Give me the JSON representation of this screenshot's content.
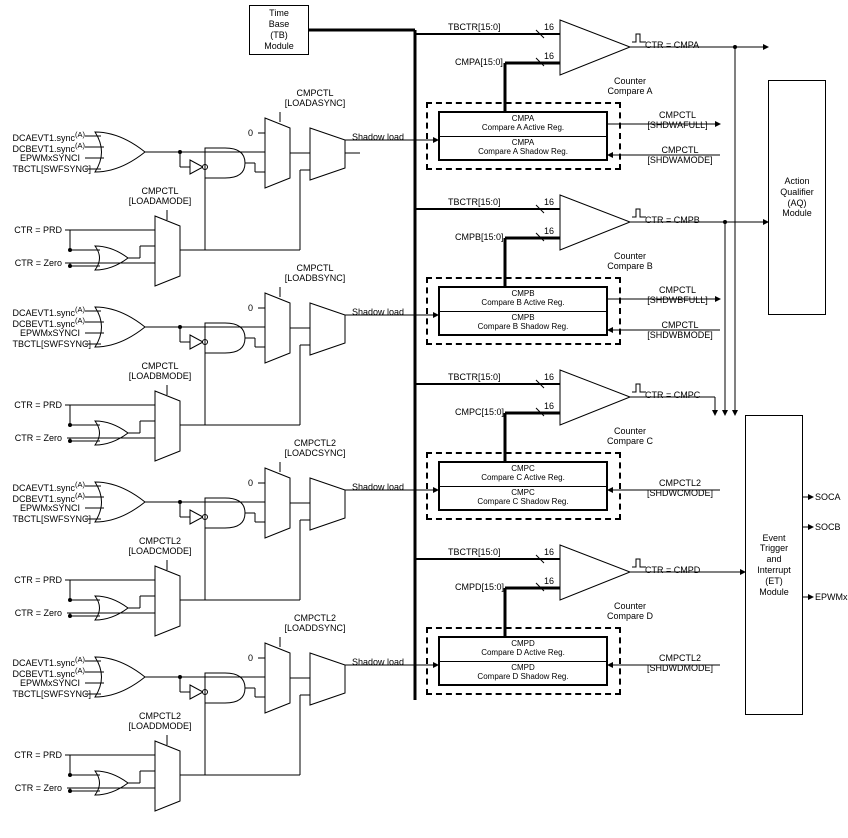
{
  "tb_module": "Time\nBase\n(TB)\nModule",
  "aq_module": "Action\nQualifier\n(AQ)\nModule",
  "et_module": "Event\nTrigger\nand\nInterrupt\n(ET)\nModule",
  "et_outputs": {
    "soca": "SOCA",
    "socb": "SOCB",
    "epwmxint": "EPWMxINT"
  },
  "sync_inputs": {
    "dcaevt1": "DCAEVT1.sync",
    "dcbevt1": "DCBEVT1.sync",
    "epwmxsynci": "EPWMxSYNCI",
    "tbctl_swfsync": "TBCTL[SWFSYNC]"
  },
  "sup_a": "(A)",
  "ctr_prd": "CTR = PRD",
  "ctr_zero": "CTR = Zero",
  "zero_lbl": "0",
  "shadow_load": "Shadow load",
  "tbctr": "TBCTR[15:0]",
  "bus16": "16",
  "blocks": {
    "A": {
      "sync": "CMPCTL\n[LOADASYNC]",
      "mode": "CMPCTL\n[LOADAMODE]",
      "cmp_bus": "CMPA[15:0]",
      "active": "CMPA\nCompare A Active Reg.",
      "shadow": "CMPA\nCompare A Shadow Reg.",
      "full": "CMPCTL\n[SHDWAFULL]",
      "shdwmode": "CMPCTL\n[SHDWAMODE]",
      "ctr_eq": "CTR = CMPA",
      "counter": "Counter\nCompare A"
    },
    "B": {
      "sync": "CMPCTL\n[LOADBSYNC]",
      "mode": "CMPCTL\n[LOADBMODE]",
      "cmp_bus": "CMPB[15:0]",
      "active": "CMPB\nCompare B Active Reg.",
      "shadow": "CMPB\nCompare B Shadow Reg.",
      "full": "CMPCTL\n[SHDWBFULL]",
      "shdwmode": "CMPCTL\n[SHDWBMODE]",
      "ctr_eq": "CTR = CMPB",
      "counter": "Counter\nCompare B"
    },
    "C": {
      "sync": "CMPCTL2\n[LOADCSYNC]",
      "mode": "CMPCTL2\n[LOADCMODE]",
      "cmp_bus": "CMPC[15:0]",
      "active": "CMPC\nCompare C Active Reg.",
      "shadow": "CMPC\nCompare C Shadow Reg.",
      "shdwmode": "CMPCTL2\n[SHDWCMODE]",
      "ctr_eq": "CTR = CMPC",
      "counter": "Counter\nCompare C"
    },
    "D": {
      "sync": "CMPCTL2\n[LOADDSYNC]",
      "mode": "CMPCTL2\n[LOADDMODE]",
      "cmp_bus": "CMPD[15:0]",
      "active": "CMPD\nCompare D Active Reg.",
      "shadow": "CMPD\nCompare D Shadow Reg.",
      "shdwmode": "CMPCTL2\n[SHDWDMODE]",
      "ctr_eq": "CTR = CMPD",
      "counter": "Counter\nCompare D"
    }
  }
}
